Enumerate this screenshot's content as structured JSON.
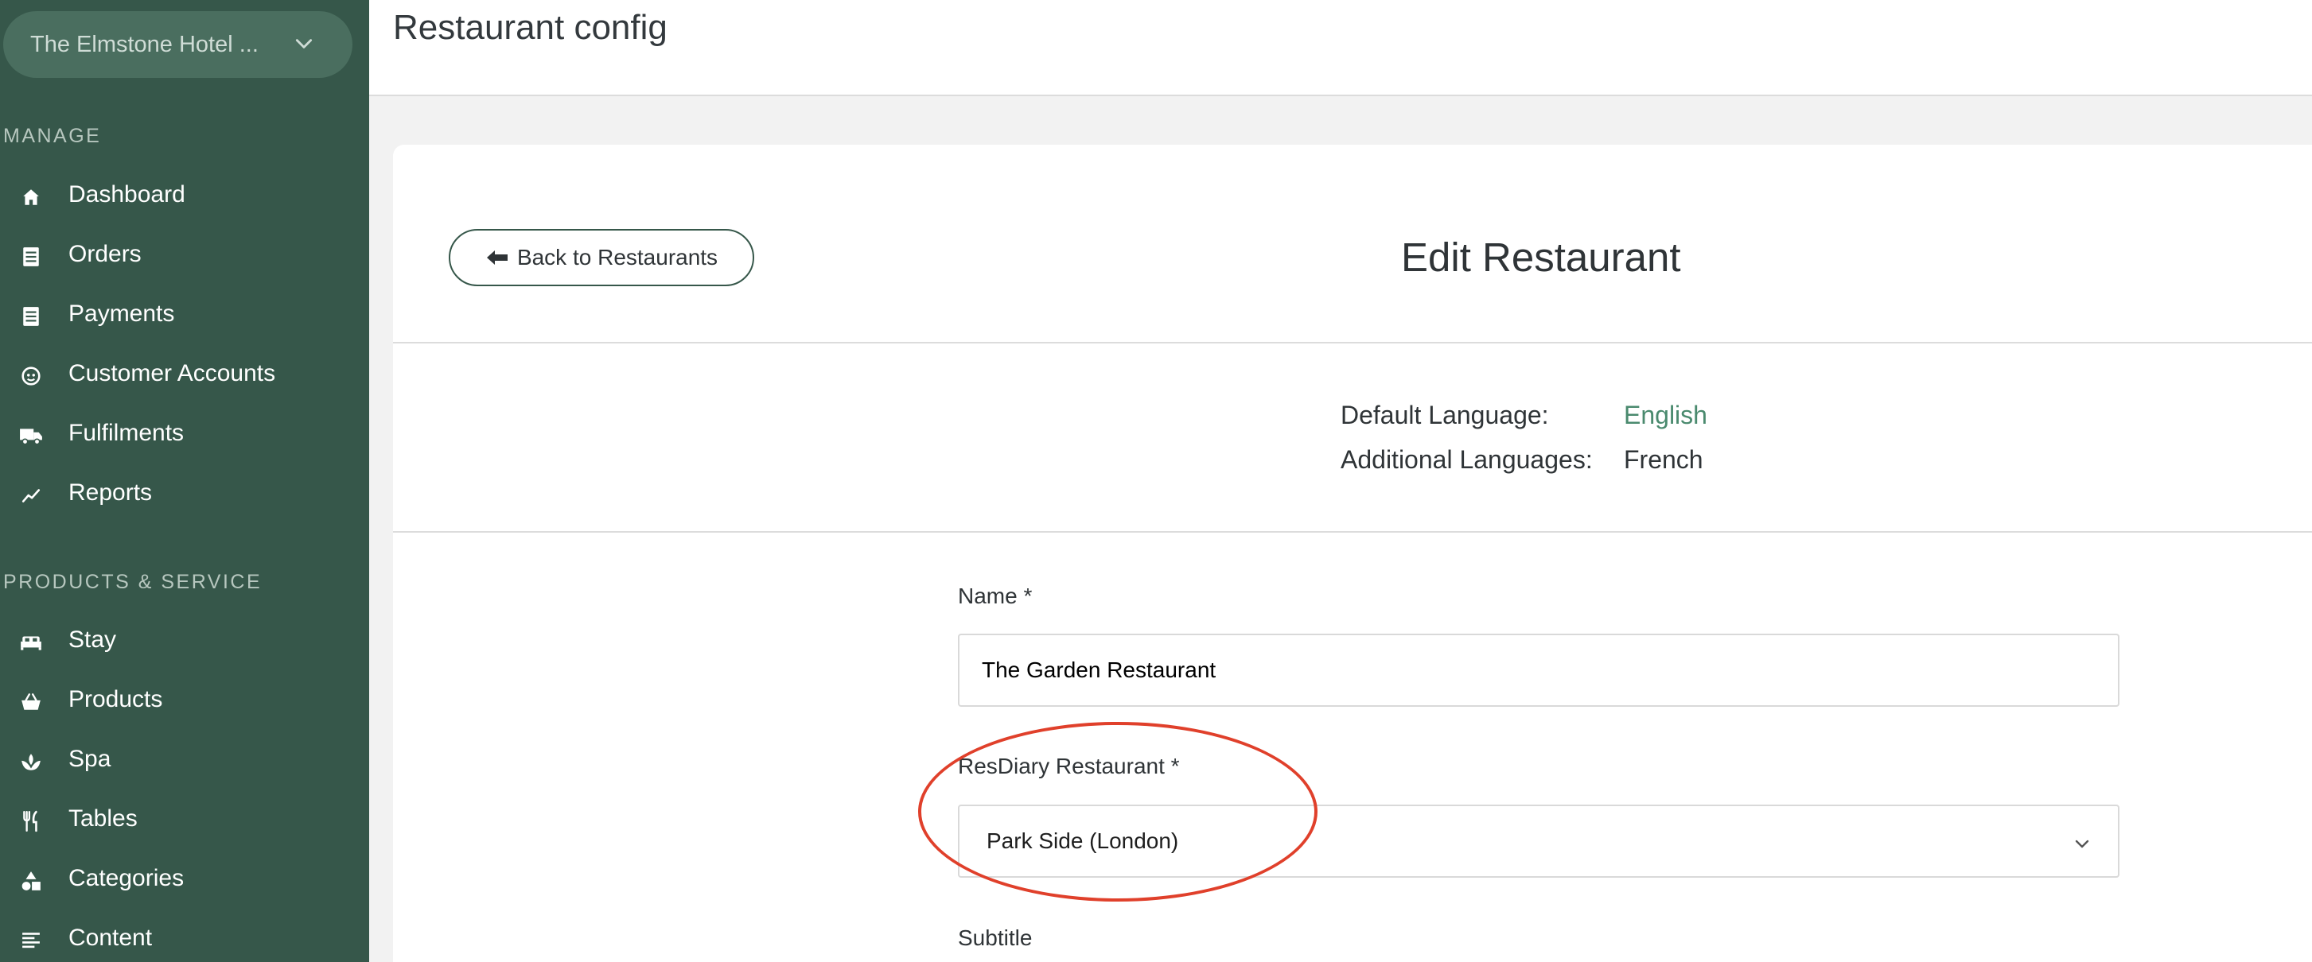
{
  "sidebar": {
    "hotel_name": "The Elmstone Hotel ...",
    "sections": [
      {
        "title": "MANAGE",
        "items": [
          {
            "label": "Dashboard",
            "icon": "home-icon"
          },
          {
            "label": "Orders",
            "icon": "list-icon"
          },
          {
            "label": "Payments",
            "icon": "list-icon"
          },
          {
            "label": "Customer Accounts",
            "icon": "face-icon"
          },
          {
            "label": "Fulfilments",
            "icon": "truck-icon"
          },
          {
            "label": "Reports",
            "icon": "trend-icon"
          }
        ]
      },
      {
        "title": "PRODUCTS & SERVICE",
        "items": [
          {
            "label": "Stay",
            "icon": "bed-icon"
          },
          {
            "label": "Products",
            "icon": "basket-icon"
          },
          {
            "label": "Spa",
            "icon": "spa-icon"
          },
          {
            "label": "Tables",
            "icon": "cutlery-icon"
          },
          {
            "label": "Categories",
            "icon": "shapes-icon"
          },
          {
            "label": "Content",
            "icon": "text-lines-icon"
          }
        ]
      }
    ]
  },
  "header": {
    "title": "Restaurant config"
  },
  "main": {
    "back_label": "Back to Restaurants",
    "title": "Edit Restaurant",
    "languages": {
      "default_label": "Default Language:",
      "default_value": "English",
      "additional_label": "Additional Languages:",
      "additional_value": "French"
    },
    "form": {
      "name_label": "Name *",
      "name_value": "The Garden Restaurant",
      "resdiary_label": "ResDiary Restaurant *",
      "resdiary_value": "Park Side (London)",
      "subtitle_label": "Subtitle"
    }
  },
  "colors": {
    "sidebar_bg": "#36574a",
    "accent_green": "#4a8a6e",
    "annotation_red": "#e0402b"
  }
}
